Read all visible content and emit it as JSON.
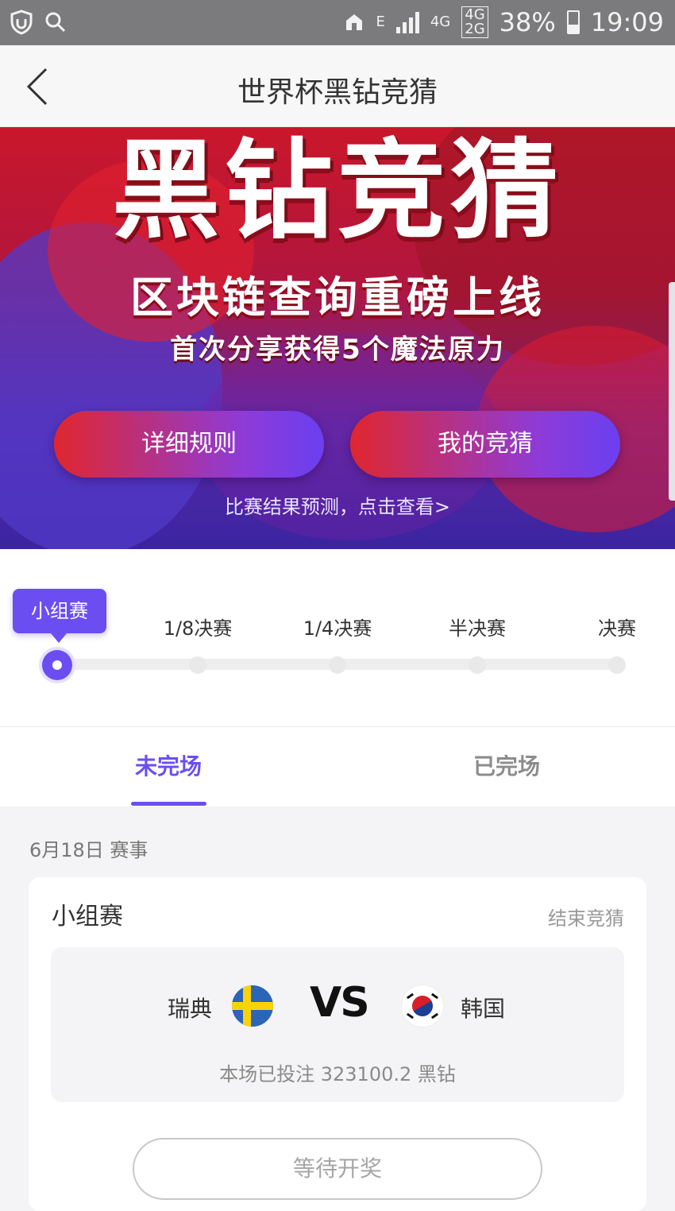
{
  "status_bar": {
    "network_type": "E",
    "lte_label": "4G",
    "dual_sim_labels": [
      "4G",
      "2G"
    ],
    "battery": "38%",
    "time": "19:09",
    "icons": [
      "shield-icon",
      "search-icon",
      "home-icon",
      "signal-icon",
      "battery-icon"
    ]
  },
  "nav": {
    "title": "世界杯黑钻竞猜",
    "back_icon": "chevron-left-icon"
  },
  "banner": {
    "headline": "黑钻竞猜",
    "subheadline": "区块链查询重磅上线",
    "promo": "首次分享获得5个魔法原力",
    "rules_button": "详细规则",
    "my_bets_button": "我的竞猜",
    "predict_link": "比赛结果预测，点击查看>",
    "colors": {
      "red": "#d81e2c",
      "purple": "#4a2fc0",
      "button_gradient_end": "#6a3ff0"
    }
  },
  "stages": {
    "active_index": 0,
    "items": [
      "小组赛",
      "1/8决赛",
      "1/4决赛",
      "半决赛",
      "决赛"
    ],
    "accent": "#6a4ef2"
  },
  "tabs": {
    "active": 0,
    "items": [
      "未完场",
      "已完场"
    ]
  },
  "date_header": "6月18日 赛事",
  "match_card": {
    "stage": "小组赛",
    "status": "结束竞猜",
    "team_a": "瑞典",
    "team_a_flag": "sweden-flag-icon",
    "vs": "VS",
    "team_b": "韩国",
    "team_b_flag": "south-korea-flag-icon",
    "bet_total": "本场已投注 323100.2 黑钻",
    "action_button": "等待开奖"
  }
}
